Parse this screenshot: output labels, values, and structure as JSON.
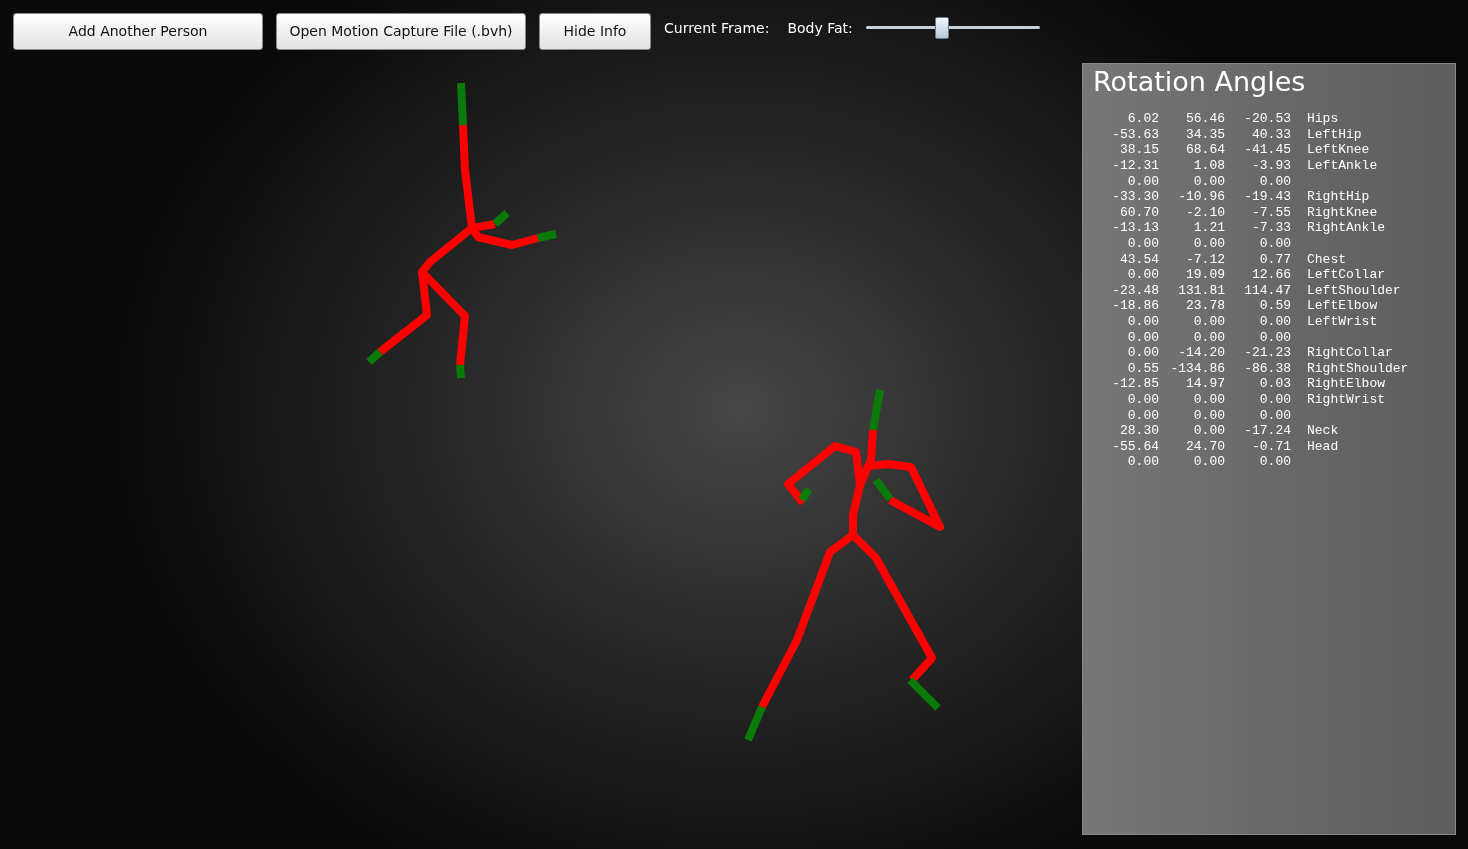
{
  "toolbar": {
    "buttons": [
      "Add Another Person",
      "Open Motion Capture File (.bvh)",
      "Hide Info"
    ],
    "current_frame_label": "Current Frame:",
    "body_fat": {
      "label": "Body Fat:",
      "level": 0.43
    }
  },
  "info_panel": {
    "title": "Rotation Angles",
    "rows": [
      {
        "values": [
          "6.02",
          "56.46",
          "-20.53"
        ],
        "joint": "Hips"
      },
      {
        "values": [
          "-53.63",
          "34.35",
          "40.33"
        ],
        "joint": "LeftHip"
      },
      {
        "values": [
          "38.15",
          "68.64",
          "-41.45"
        ],
        "joint": "LeftKnee"
      },
      {
        "values": [
          "-12.31",
          "1.08",
          "-3.93"
        ],
        "joint": "LeftAnkle"
      },
      {
        "values": [
          "0.00",
          "0.00",
          "0.00"
        ]
      },
      {
        "values": [
          "-33.30",
          "-10.96",
          "-19.43"
        ],
        "joint": "RightHip"
      },
      {
        "values": [
          "60.70",
          "-2.10",
          "-7.55"
        ],
        "joint": "RightKnee"
      },
      {
        "values": [
          "-13.13",
          "1.21",
          "-7.33"
        ],
        "joint": "RightAnkle"
      },
      {
        "values": [
          "0.00",
          "0.00",
          "0.00"
        ]
      },
      {
        "values": [
          "43.54",
          "-7.12",
          "0.77"
        ],
        "joint": "Chest"
      },
      {
        "values": [
          "0.00",
          "19.09",
          "12.66"
        ],
        "joint": "LeftCollar"
      },
      {
        "values": [
          "-23.48",
          "131.81",
          "114.47"
        ],
        "joint": "LeftShoulder"
      },
      {
        "values": [
          "-18.86",
          "23.78",
          "0.59"
        ],
        "joint": "LeftElbow"
      },
      {
        "values": [
          "0.00",
          "0.00",
          "0.00"
        ],
        "joint": "LeftWrist"
      },
      {
        "values": [
          "0.00",
          "0.00",
          "0.00"
        ]
      },
      {
        "values": [
          "0.00",
          "-14.20",
          "-21.23"
        ],
        "joint": "RightCollar"
      },
      {
        "values": [
          "0.55",
          "-134.86",
          "-86.38"
        ],
        "joint": "RightShoulder"
      },
      {
        "values": [
          "-12.85",
          "14.97",
          "0.03"
        ],
        "joint": "RightElbow"
      },
      {
        "values": [
          "0.00",
          "0.00",
          "0.00"
        ],
        "joint": "RightWrist"
      },
      {
        "values": [
          "0.00",
          "0.00",
          "0.00"
        ]
      },
      {
        "values": [
          "28.30",
          "0.00",
          "-17.24"
        ],
        "joint": "Neck"
      },
      {
        "values": [
          "-55.64",
          "24.70",
          "-0.71"
        ],
        "joint": "Head"
      },
      {
        "values": [
          "0.00",
          "0.00",
          "0.00"
        ]
      }
    ]
  }
}
